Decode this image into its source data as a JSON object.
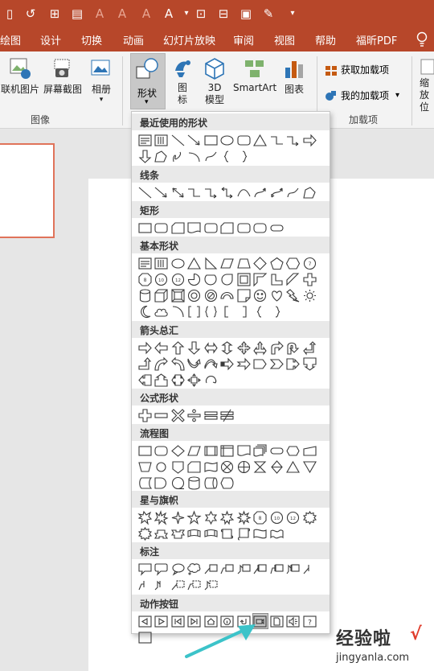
{
  "ribbon_tabs": [
    "绘图",
    "设计",
    "切换",
    "动画",
    "幻灯片放映",
    "审阅",
    "视图",
    "帮助",
    "福昕PDF"
  ],
  "ribbon": {
    "online_pictures": "联机图片",
    "screenshot": "屏幕截图",
    "album": "相册",
    "images_group": "图像",
    "shapes": "形状",
    "icons": "图\n标",
    "model3d": "3D\n模型",
    "smartart": "SmartArt",
    "chart": "图表",
    "get_addins": "获取加载项",
    "my_addins": "我的加载项",
    "addins_group": "加载项",
    "zoom_partial": "缩放\n位"
  },
  "dropdown": {
    "sections": [
      "最近使用的形状",
      "线条",
      "矩形",
      "基本形状",
      "箭头总汇",
      "公式形状",
      "流程图",
      "星与旗帜",
      "标注",
      "动作按钮"
    ]
  },
  "watermark": {
    "title": "经验啦",
    "check": "√",
    "url": "jingyanla.com"
  },
  "colors": {
    "accent": "#b7472a",
    "highlight_arrow": "#3cc3c9"
  }
}
